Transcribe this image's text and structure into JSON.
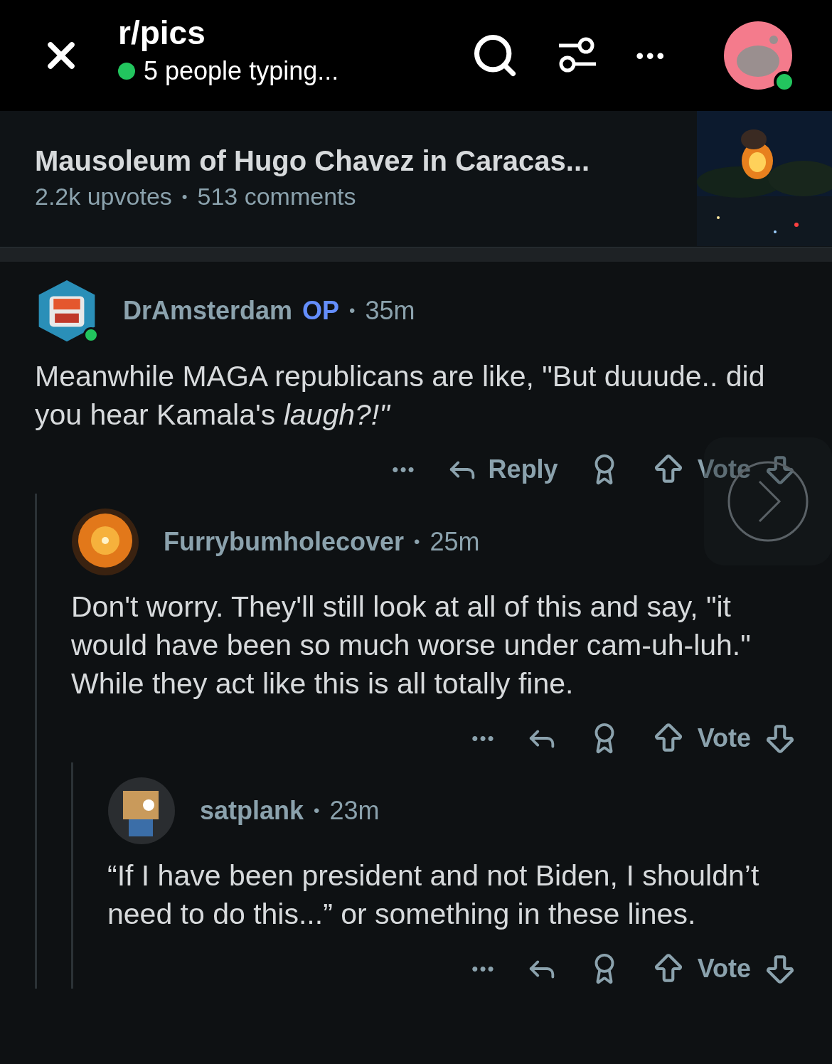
{
  "header": {
    "title": "r/pics",
    "status": "5 people typing...",
    "online": true,
    "more": "•••"
  },
  "post": {
    "title": "Mausoleum of Hugo Chavez in Caracas...",
    "upvotes": "2.2k upvotes",
    "separator": "•",
    "comments": "513 comments"
  },
  "comments": [
    {
      "author": "DrAmsterdam",
      "badge": "OP",
      "separator": "•",
      "time": "35m",
      "online": true,
      "body": "Meanwhile MAGA republicans are like, \"But duuude.. did you hear Kamala's *laugh?!\"*",
      "actions": {
        "more": "•••",
        "reply_label": "Reply",
        "vote_label": "Vote"
      },
      "children": [
        {
          "author": "Furrybumholecover",
          "separator": "•",
          "time": "25m",
          "online": false,
          "body": "Don't worry. They'll still look at all of this and say, \"it would have been so much worse under cam-uh-luh.\" While they act like this is all totally fine.",
          "actions": {
            "more": "•••",
            "vote_label": "Vote"
          },
          "children": [
            {
              "author": "satplank",
              "separator": "•",
              "time": "23m",
              "online": false,
              "body": "“If I have been president and not Biden, I shouldn’t need to do this...” or something in these lines.",
              "actions": {
                "more": "•••",
                "vote_label": "Vote"
              }
            }
          ]
        }
      ]
    }
  ]
}
